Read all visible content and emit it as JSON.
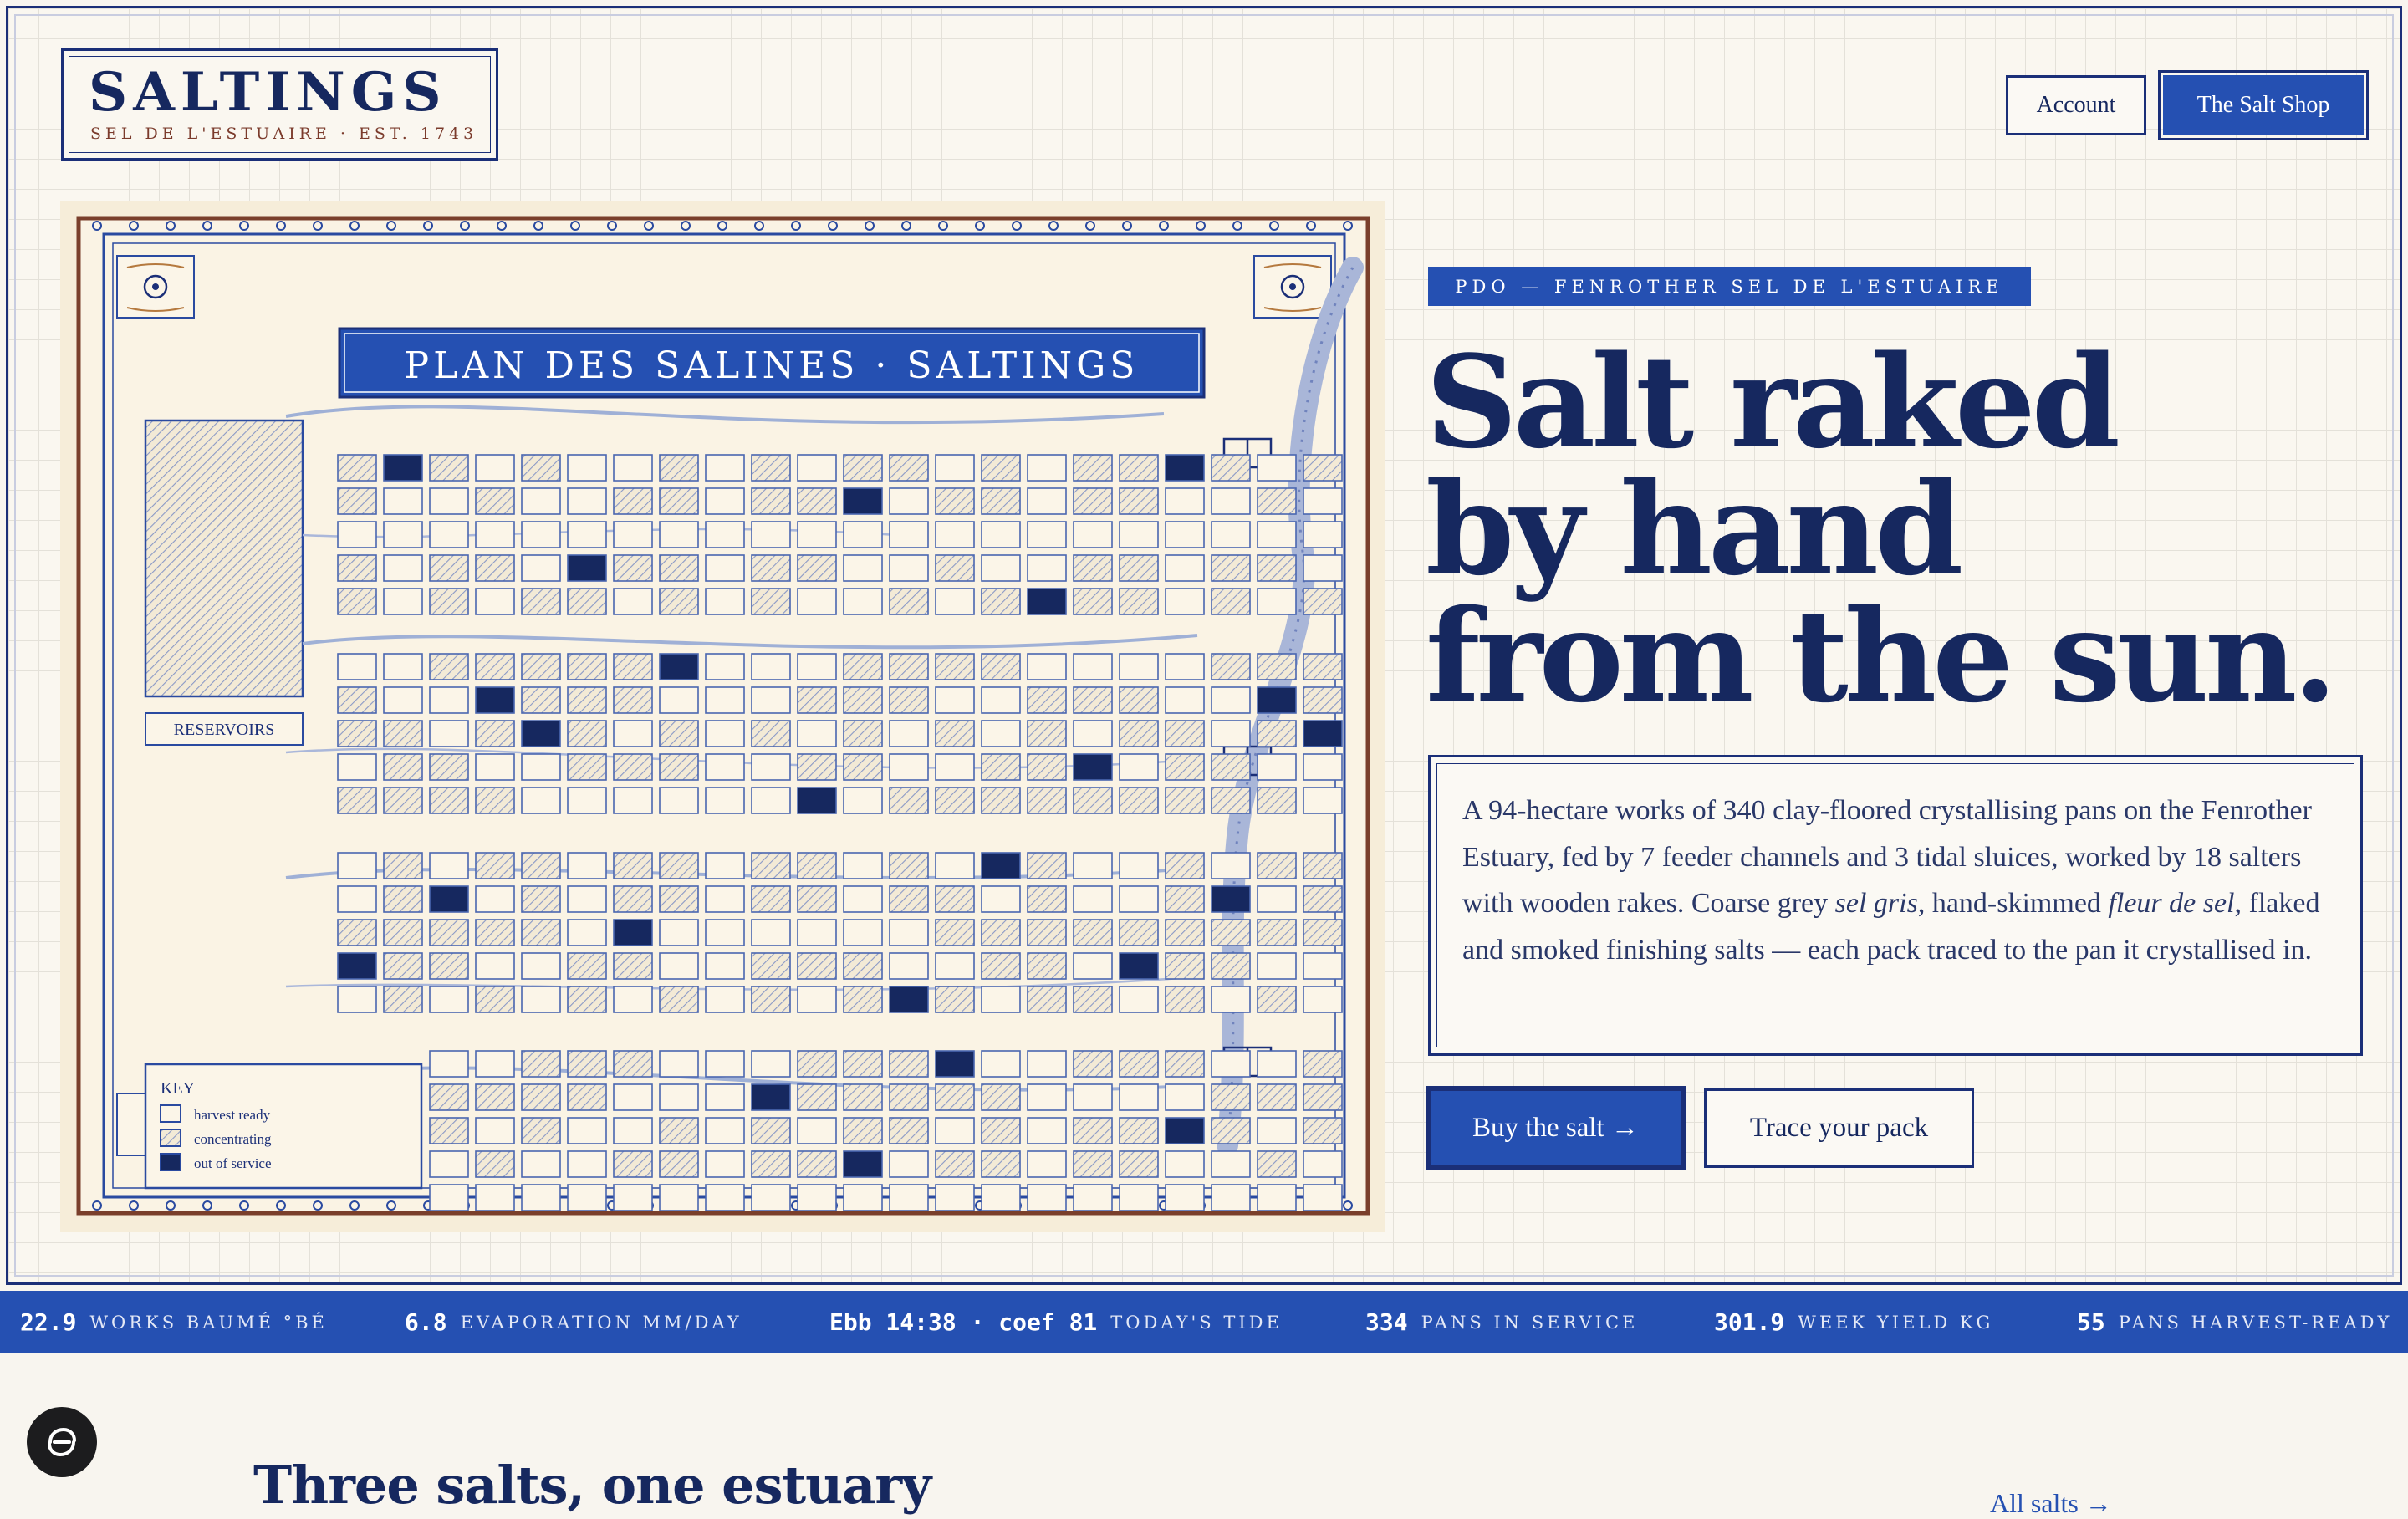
{
  "header": {
    "logo_title": "SALTINGS",
    "logo_subtitle": "SEL DE L'ESTUAIRE · EST. 1743",
    "account_label": "Account",
    "shop_label": "The Salt Shop"
  },
  "map": {
    "banner": "PLAN DES SALINES · SALTINGS",
    "reservoir_label": "RESERVOIRS",
    "key_title": "KEY",
    "key_items": [
      "harvest ready",
      "concentrating",
      "out of service"
    ]
  },
  "hero": {
    "badge": "PDO — FENROTHER SEL DE L'ESTUAIRE",
    "headline_lines": [
      "Salt raked",
      "by hand",
      "from the sun."
    ],
    "desc_1": "A 94-hectare works of 340 clay-floored crystallising pans on the Fenrother Estuary, fed by 7 feeder channels and 3 tidal sluices, worked by 18 salters with wooden rakes. Coarse grey ",
    "desc_em1": "sel gris",
    "desc_2": ", hand-skimmed ",
    "desc_em2": "fleur de sel",
    "desc_3": ", flaked and smoked finishing salts — each pack traced to the pan it crystallised in.",
    "buy_label": "Buy the salt →",
    "trace_label": "Trace your pack"
  },
  "ticker": [
    {
      "value": "22.9",
      "label": "WORKS BAUMÉ °BÉ"
    },
    {
      "value": "6.8",
      "label": "EVAPORATION MM/DAY"
    },
    {
      "value": "Ebb 14:38 · coef 81",
      "label": "TODAY'S TIDE"
    },
    {
      "value": "334",
      "label": "PANS IN SERVICE"
    },
    {
      "value": "301.9",
      "label": "WEEK YIELD KG"
    },
    {
      "value": "55",
      "label": "PANS HARVEST-READY"
    }
  ],
  "section": {
    "title": "Three salts, one estuary",
    "all_link": "All salts →"
  },
  "colors": {
    "navy": "#16285f",
    "royal_blue": "#2550b2",
    "rust": "#7b3b2c",
    "paper": "#f6edd9"
  }
}
